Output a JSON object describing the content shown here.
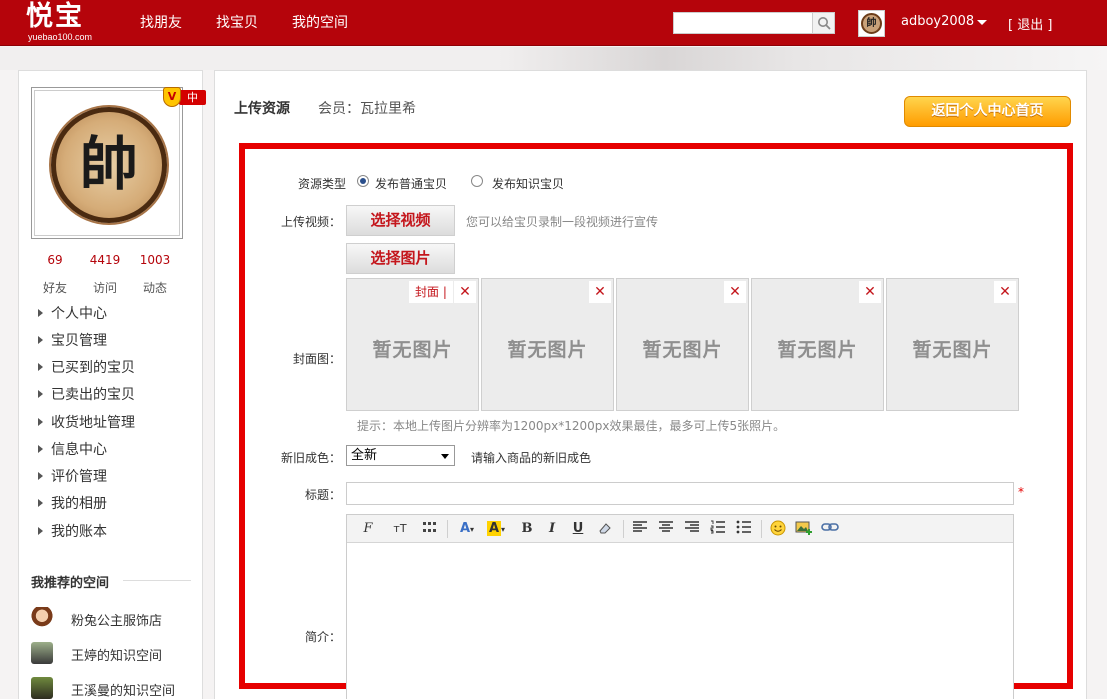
{
  "header": {
    "logo": "悦宝",
    "logo_sub": "yuebao100.com",
    "nav": [
      "找朋友",
      "找宝贝",
      "我的空间"
    ],
    "search_placeholder": "",
    "username": "adboy2008",
    "logout": "[ 退出 ]",
    "avatar_glyph": "帥"
  },
  "sidebar": {
    "avatar_glyph": "帥",
    "vip_letter": "V",
    "vip_level": "中",
    "stats": [
      {
        "value": "69",
        "label": "好友"
      },
      {
        "value": "4419",
        "label": "访问"
      },
      {
        "value": "1003",
        "label": "动态"
      }
    ],
    "menu": [
      "个人中心",
      "宝贝管理",
      "已买到的宝贝",
      "已卖出的宝贝",
      "收货地址管理",
      "信息中心",
      "评价管理",
      "我的相册",
      "我的账本"
    ],
    "recommended_title": "我推荐的空间",
    "recommended": [
      "粉兔公主服饰店",
      "王婷的知识空间",
      "王溪曼的知识空间"
    ]
  },
  "main": {
    "title": "上传资源",
    "member": "会员：瓦拉里希",
    "back_button": "返回个人中心首页",
    "form": {
      "type_label": "资源类型",
      "type_options": [
        "发布普通宝贝",
        "发布知识宝贝"
      ],
      "type_selected": 0,
      "video_label": "上传视频：",
      "video_button": "选择视频",
      "video_hint": "您可以给宝贝录制一段视频进行宣传",
      "image_button": "选择图片",
      "cover_label": "封面图：",
      "cover_tag": "封面",
      "cover_tag_sep": "|",
      "cover_close": "✕",
      "cover_placeholder": "暂无图片",
      "cover_count": 5,
      "cover_hint": "提示：本地上传图片分辨率为1200px*1200px效果最佳，最多可上传5张照片。",
      "condition_label": "新旧成色：",
      "condition_value": "全新",
      "condition_hint": "请输入商品的新旧成色",
      "title_label": "标题：",
      "title_value": "",
      "required_mark": "*",
      "intro_label": "简介："
    },
    "toolbar": {
      "font_family": "F",
      "font_size": "тT",
      "bold": "B",
      "italic": "I",
      "underline": "U"
    }
  },
  "colors": {
    "brand_red": "#b5040b",
    "frame_red": "#e60000",
    "button_orange": "#ff9c00"
  }
}
